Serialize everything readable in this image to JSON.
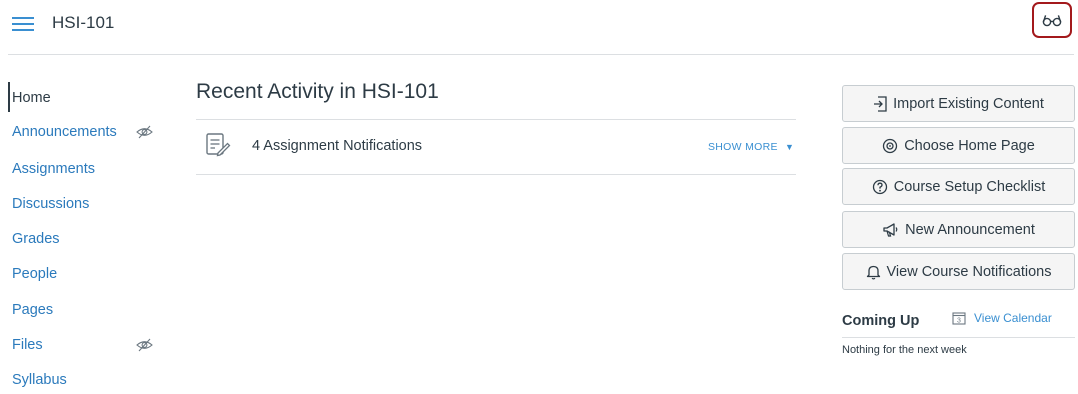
{
  "header": {
    "menu_icon": "hamburger-icon",
    "course_title": "HSI-101",
    "student_view_icon": "glasses-icon",
    "accent_color": "#3a8fd1",
    "highlight_color": "#a3191c"
  },
  "nav": {
    "items": [
      {
        "label": "Home",
        "active": true,
        "hidden": false
      },
      {
        "label": "Announcements",
        "active": false,
        "hidden": true
      },
      {
        "label": "Assignments",
        "active": false,
        "hidden": false
      },
      {
        "label": "Discussions",
        "active": false,
        "hidden": false
      },
      {
        "label": "Grades",
        "active": false,
        "hidden": false
      },
      {
        "label": "People",
        "active": false,
        "hidden": false
      },
      {
        "label": "Pages",
        "active": false,
        "hidden": false
      },
      {
        "label": "Files",
        "active": false,
        "hidden": true
      },
      {
        "label": "Syllabus",
        "active": false,
        "hidden": false
      }
    ],
    "link_color": "#2b7abc"
  },
  "main": {
    "title": "Recent Activity in HSI-101",
    "notification": {
      "icon": "assignment-icon",
      "text": "4 Assignment Notifications",
      "show_more": "SHOW MORE"
    }
  },
  "sidebar": {
    "buttons": [
      {
        "label": "Import Existing Content",
        "icon": "import-icon"
      },
      {
        "label": "Choose Home Page",
        "icon": "target-icon"
      },
      {
        "label": "Course Setup Checklist",
        "icon": "question-icon"
      },
      {
        "label": "New Announcement",
        "icon": "megaphone-icon"
      },
      {
        "label": "View Course Notifications",
        "icon": "bell-icon"
      }
    ],
    "coming_up": {
      "title": "Coming Up",
      "calendar_link": "View Calendar",
      "calendar_icon": "calendar-icon",
      "calendar_day": "3",
      "empty_text": "Nothing for the next week"
    }
  }
}
